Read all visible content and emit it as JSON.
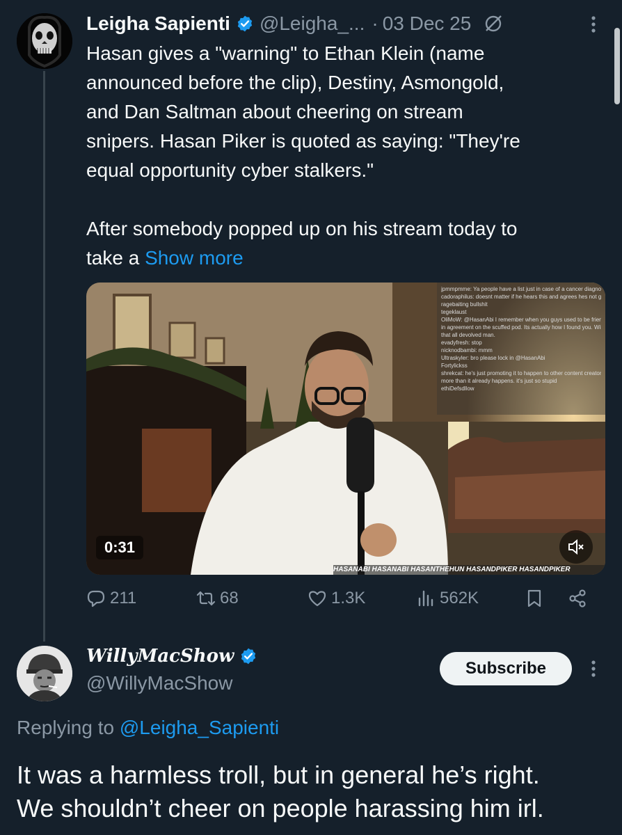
{
  "tweet": {
    "author_name": "Leigha Sapienti",
    "handle": "@Leigha_...",
    "separator": "·",
    "date": "03 Dec 25",
    "text_lines": [
      "Hasan gives a \"warning\"  to Ethan Klein (name",
      "announced before the clip), Destiny, Asmongold,",
      "and Dan Saltman about cheering on stream",
      "snipers. Hasan Piker  is quoted as saying:  \"They're",
      "equal opportunity cyber stalkers.\""
    ],
    "text_line6": "After somebody popped up on his stream today to",
    "text_line7_prefix": "take a ",
    "show_more": "Show more",
    "video": {
      "timestamp": "0:31",
      "muted": true,
      "chat_lines": [
        "jpmmpmme: Ya people have a list just in case of a cancer diagnosis",
        "cadoraphilus: doesnt matter if he hears this and agrees hes not gonna change his",
        "ragebaiting bullshit",
        "tegeklaust",
        "OliMoW: @HasanAbi I remember when you guys used to be friends and",
        "in agreement on the scuffed pod. Its actually how I found you. Wild how quickly",
        "that all devolved man.",
        "evadyfresh: stop",
        "nicknodbambi: mmm",
        "Ultraskyler: bro please lock in @HasanAbi",
        "Fortylickss",
        "shrekcat: he's just promoting it to happen to other content creators even",
        "more than it already happens. it's just so stupid",
        "ethiDefsdllow"
      ],
      "social_banner": "HASANABI  HASANABI  HASANTHEHUN  HASANDPIKER  HASANDPIKER"
    },
    "stats": {
      "replies": "211",
      "reposts": "68",
      "likes": "1.3K",
      "views": "562K"
    }
  },
  "reply": {
    "author_name": "WillyMacShow",
    "handle": "@WillyMacShow",
    "subscribe_label": "Subscribe",
    "replying_prefix": "Replying to ",
    "replying_to": "@Leigha_Sapienti",
    "text_lines": [
      "It was a harmless troll, but in general he’s right.",
      "We shouldn’t cheer on people harassing him irl."
    ]
  },
  "colors": {
    "background": "#15202b",
    "accent": "#1d9bf0",
    "muted_text": "#8b98a5"
  }
}
